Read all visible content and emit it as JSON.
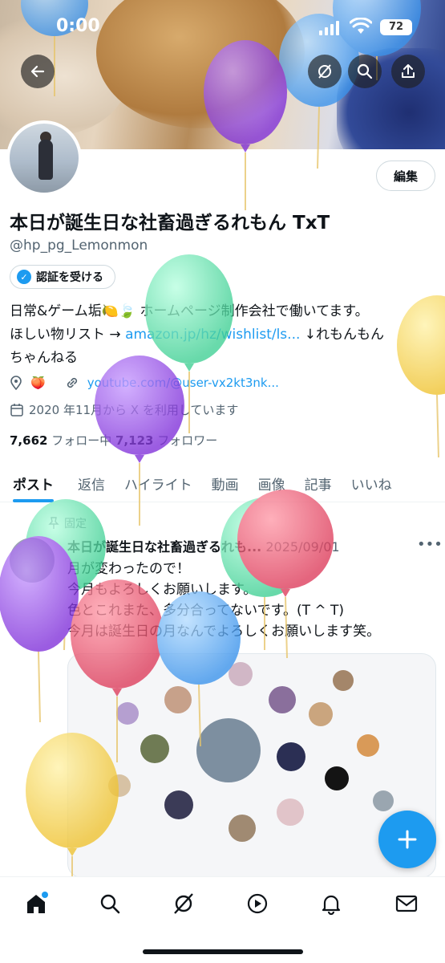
{
  "status": {
    "time": "0:00",
    "battery": "72"
  },
  "profile": {
    "name": "本日が誕生日な社畜過ぎるれもん TxT",
    "handle": "@hp_pg_Lemonmon",
    "edit_label": "編集",
    "verify_label": "認証を受ける",
    "bio_line1": "日常&ゲーム垢🍋🍃 ホームページ制作会社で働いてます。",
    "bio_line2_text": "ほしい物リスト → ",
    "bio_line2_link": "amazon.jp/hz/wishlist/ls...",
    "bio_line2_tail": " ↓れもんもん",
    "bio_line3": "ちゃんねる",
    "location_emoji": "🍑",
    "website": "youtube.com/@user-vx2kt3nk...",
    "joined": "2020 年11月から X を利用しています",
    "following_count": "7,662",
    "following_label": " フォロー中  ",
    "followers_count": "7,123",
    "followers_label": " フォロワー"
  },
  "tabs": [
    "ポスト",
    "返信",
    "ハイライト",
    "動画",
    "画像",
    "記事",
    "いいね"
  ],
  "post": {
    "pinned_label": "固定",
    "author": "本日が誕生日な社畜過ぎるれも...",
    "date": "2025/09/01",
    "line1": "月が変わったので！",
    "line2": "今月もよろしくお願いします。",
    "line3": "色とこれまた、多分合ってないです。(T ^ T)",
    "line4": "今月は誕生日の月なんでよろしくお願いします笑。"
  },
  "colors": {
    "accent": "#1d9bf0",
    "purple": "#8e44e6",
    "green": "#5fe0ae",
    "yellow": "#f5cd3f",
    "red": "#e8506a",
    "blue": "#4da8f5"
  },
  "icons": [
    "back-arrow-icon",
    "grok-icon",
    "search-icon",
    "share-icon",
    "location-icon",
    "link-icon",
    "calendar-icon",
    "pin-icon",
    "more-icon",
    "home-icon",
    "explore-icon",
    "grok-nav-icon",
    "video-icon",
    "bell-icon",
    "mail-icon",
    "plus-icon"
  ]
}
